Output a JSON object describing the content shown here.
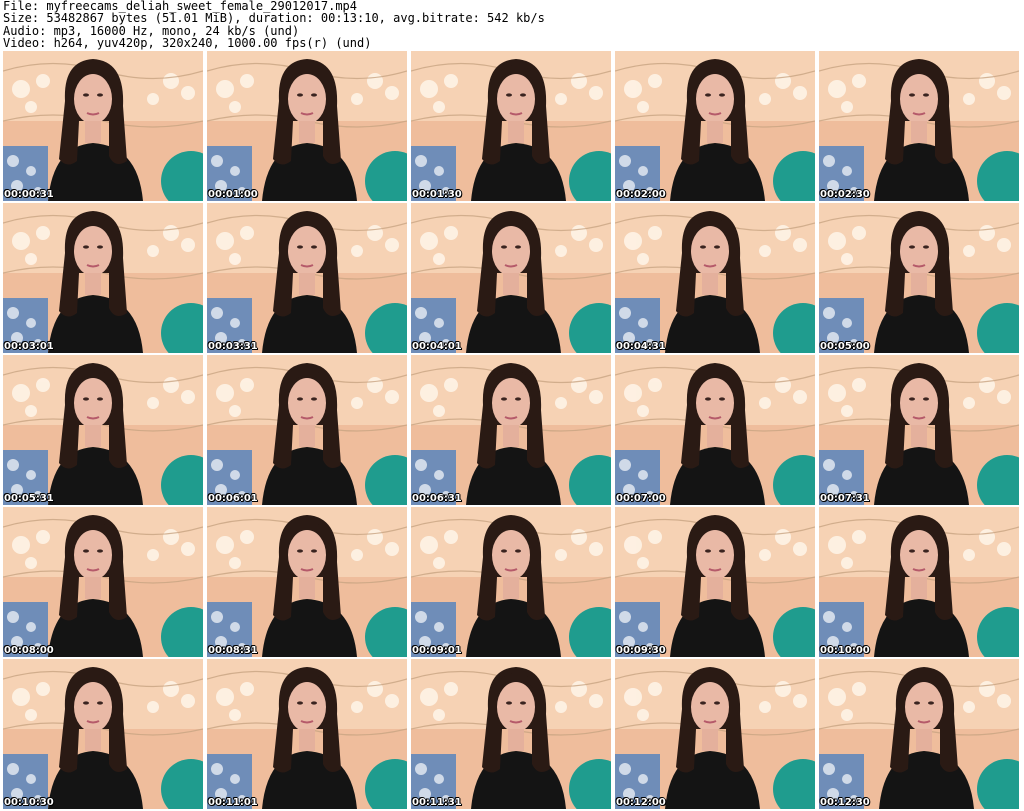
{
  "header": {
    "file": "File: myfreecams_deliah_sweet_female_29012017.mp4",
    "size": "Size: 53482867 bytes (51.01 MiB), duration: 00:13:10, avg.bitrate: 542 kb/s",
    "audio": "Audio: mp3, 16000 Hz, mono, 24 kb/s (und)",
    "video": "Video: h264, yuv420p, 320x240, 1000.00 fps(r) (und)"
  },
  "thumbnails": [
    {
      "timestamp": "00:00:31"
    },
    {
      "timestamp": "00:01:00"
    },
    {
      "timestamp": "00:01:30"
    },
    {
      "timestamp": "00:02:00"
    },
    {
      "timestamp": "00:02:30"
    },
    {
      "timestamp": "00:03:01"
    },
    {
      "timestamp": "00:03:31"
    },
    {
      "timestamp": "00:04:01"
    },
    {
      "timestamp": "00:04:31"
    },
    {
      "timestamp": "00:05:00"
    },
    {
      "timestamp": "00:05:31"
    },
    {
      "timestamp": "00:06:01"
    },
    {
      "timestamp": "00:06:31"
    },
    {
      "timestamp": "00:07:00"
    },
    {
      "timestamp": "00:07:31"
    },
    {
      "timestamp": "00:08:00"
    },
    {
      "timestamp": "00:08:31"
    },
    {
      "timestamp": "00:09:01"
    },
    {
      "timestamp": "00:09:30"
    },
    {
      "timestamp": "00:10:00"
    },
    {
      "timestamp": "00:10:30"
    },
    {
      "timestamp": "00:11:01"
    },
    {
      "timestamp": "00:11:31"
    },
    {
      "timestamp": "00:12:00"
    },
    {
      "timestamp": "00:12:30"
    }
  ]
}
